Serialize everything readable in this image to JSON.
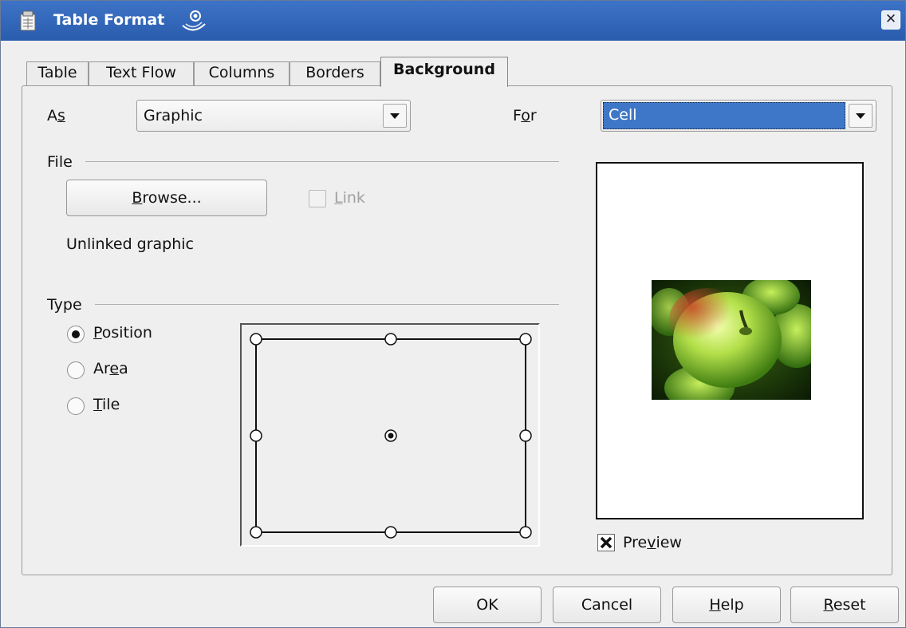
{
  "window": {
    "title": "Table Format",
    "close_glyph": "✕"
  },
  "tabs": [
    "Table",
    "Text Flow",
    "Columns",
    "Borders",
    "Background"
  ],
  "active_tab": "Background",
  "as": {
    "label_pre": "A",
    "label_mnemonic": "s",
    "value": "Graphic"
  },
  "for": {
    "label_pre": "F",
    "label_mnemonic": "o",
    "label_post": "r",
    "value": "Cell"
  },
  "file": {
    "group_label": "File",
    "browse_mnemonic": "B",
    "browse_rest": "rowse...",
    "link_mnemonic": "L",
    "link_rest": "ink",
    "status": "Unlinked graphic"
  },
  "type": {
    "group_label": "Type",
    "position": {
      "mnemonic": "P",
      "rest": "osition",
      "checked": true
    },
    "area": {
      "pre": "Ar",
      "mnemonic": "e",
      "post": "a",
      "checked": false
    },
    "tile": {
      "mnemonic": "T",
      "rest": "ile",
      "checked": false
    },
    "selected_position": "center"
  },
  "preview": {
    "pre": "Pre",
    "mnemonic": "v",
    "post": "iew",
    "checked": true,
    "image": "green-apple-photo"
  },
  "buttons": {
    "ok": "OK",
    "cancel": "Cancel",
    "help": {
      "mnemonic": "H",
      "rest": "elp"
    },
    "reset": {
      "mnemonic": "R",
      "rest": "eset"
    }
  },
  "colors": {
    "titlebar": "#2f64b8",
    "selection": "#3f77c8",
    "dialog_bg": "#efefef"
  }
}
